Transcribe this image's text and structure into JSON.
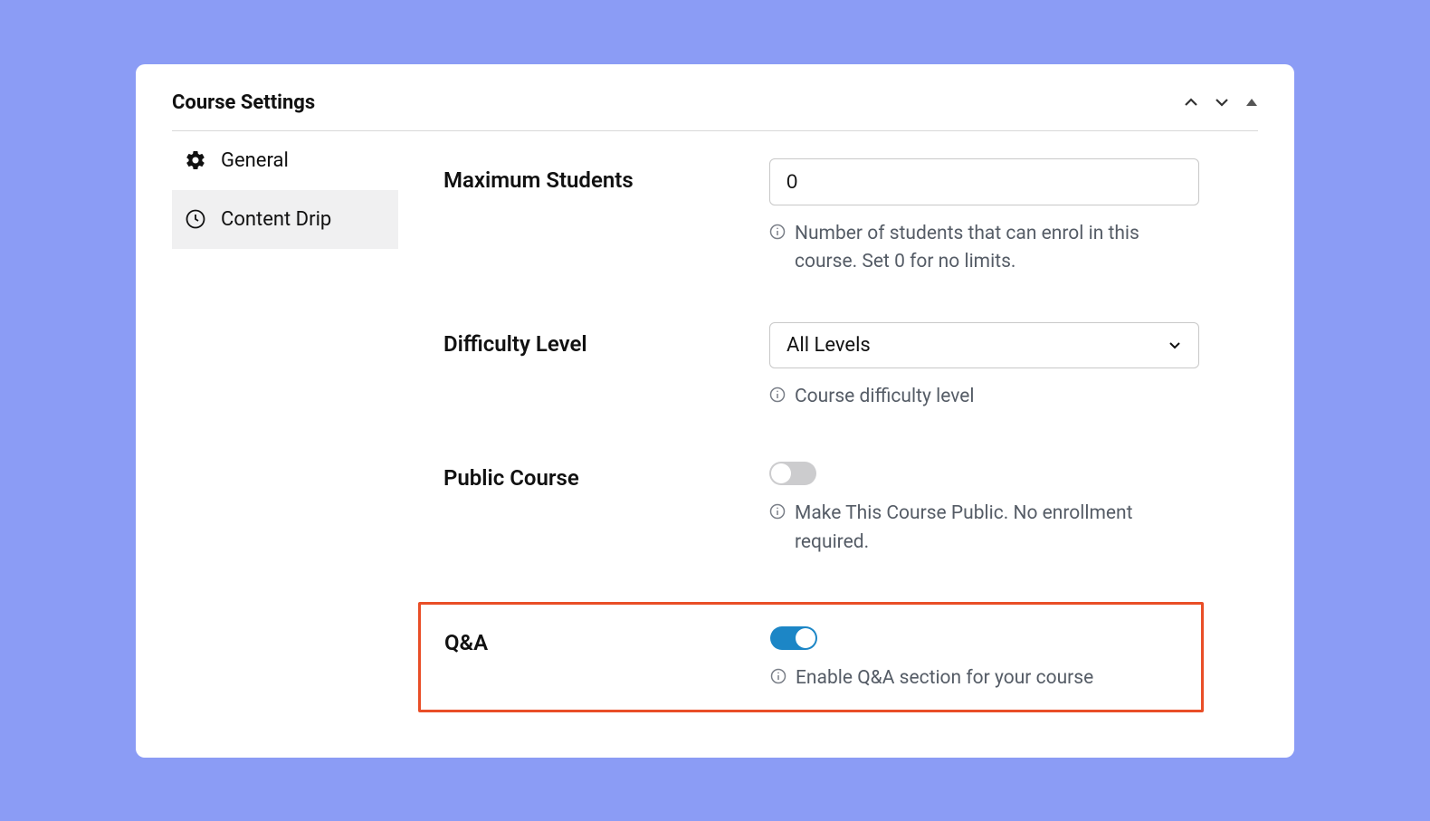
{
  "panel": {
    "title": "Course Settings"
  },
  "sidebar": {
    "items": [
      {
        "label": "General"
      },
      {
        "label": "Content Drip"
      }
    ]
  },
  "settings": {
    "maxStudents": {
      "label": "Maximum Students",
      "value": "0",
      "help": "Number of students that can enrol in this course. Set 0 for no limits."
    },
    "difficulty": {
      "label": "Difficulty Level",
      "value": "All Levels",
      "help": "Course difficulty level"
    },
    "publicCourse": {
      "label": "Public Course",
      "enabled": false,
      "help": "Make This Course Public. No enrollment required."
    },
    "qa": {
      "label": "Q&A",
      "enabled": true,
      "help": "Enable Q&A section for your course"
    }
  }
}
